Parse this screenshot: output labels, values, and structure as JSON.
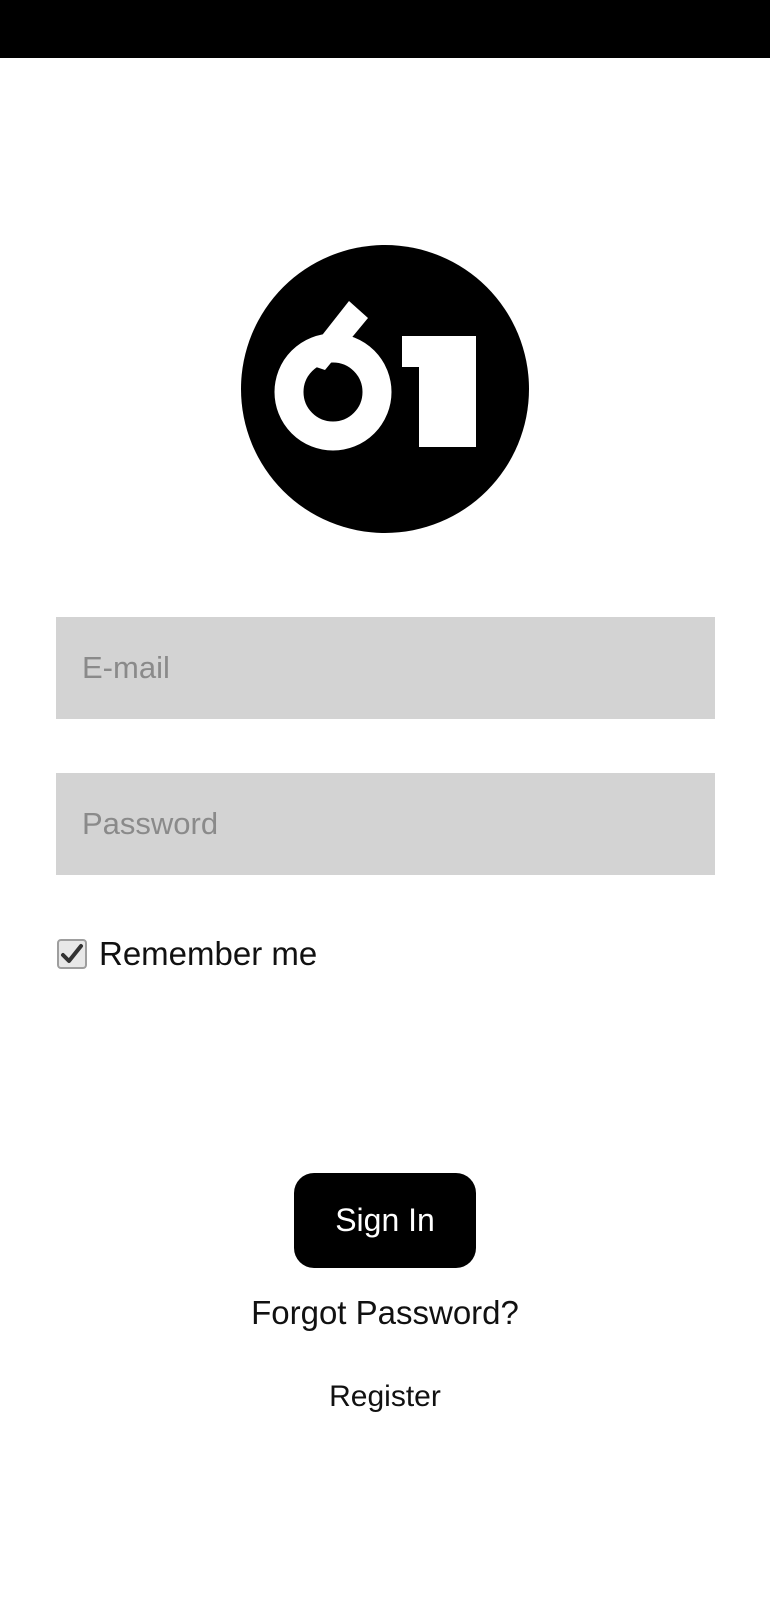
{
  "status_bar": {
    "color": "#000000"
  },
  "logo": {
    "icon": "sixty-one-logo-icon",
    "text": "61",
    "color": "#000000"
  },
  "form": {
    "email": {
      "placeholder": "E-mail",
      "value": ""
    },
    "password": {
      "placeholder": "Password",
      "value": ""
    },
    "remember": {
      "label": "Remember me",
      "checked": true
    }
  },
  "actions": {
    "sign_in_label": "Sign In",
    "forgot_password_label": "Forgot Password?",
    "register_label": "Register"
  },
  "colors": {
    "accent": "#000000",
    "field_background": "#d3d3d3",
    "placeholder": "#8a8a8a"
  }
}
